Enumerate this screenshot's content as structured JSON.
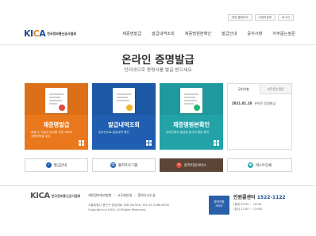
{
  "util_links": [
    "대표 홈페이지",
    "사용자등록",
    "로그인"
  ],
  "header": {
    "logo_mark_main": "KI",
    "logo_mark_accent": "C",
    "logo_mark_end": "A",
    "logo_text": "한국정보통신공사협회",
    "nav": [
      "제증명발급",
      "발급내역조회",
      "제증명원본확인",
      "발급안내",
      "공지사항",
      "자주묻는질문"
    ]
  },
  "hero": {
    "title": "온라인 증명발급",
    "subtitle": "인터넷으로 증명서를 발급 받으세요"
  },
  "cards": [
    {
      "title": "제증명발급",
      "desc": "회원사, 기술자·감리원 관련 자료의 제증명원을 발급"
    },
    {
      "title": "발급내역조회",
      "desc": "온라인으로 발급내역 확인"
    },
    {
      "title": "제증명원본확인",
      "desc": "온라인에서 발급된 문서의 원본 확인"
    }
  ],
  "notice": {
    "tabs": [
      "공지사항",
      "자주묻는질문"
    ],
    "items": [
      {
        "date": "2021.01.10",
        "title": "온라인 증명발급"
      }
    ]
  },
  "buttons": [
    {
      "label": "발급안내",
      "icon": "check-icon",
      "color": "#1f5eb0"
    },
    {
      "label": "출력프로그램",
      "icon": "print-icon",
      "color": "#1f5eb0"
    },
    {
      "label": "원격지원서비스",
      "icon": "support-icon",
      "color": "#e24b3b"
    },
    {
      "label": "테스트인쇄",
      "icon": "test-print-icon",
      "color": "#23a3a8"
    }
  ],
  "footer": {
    "logo_text": "한국정보통신공사협회",
    "links": [
      "개인정보처리방침",
      "시도회안내",
      "찾아오시는길"
    ],
    "address": "서울특별시 용산구 한강대로 308 (04334)   TEL 02-3488-6000",
    "copyright": "Copyright (c) KICA. All Rights Reserved.",
    "cs_badge_line1": "원격지원",
    "cs_badge_line2": "서비스",
    "cs_label": "민원콜센터",
    "cs_number": "1522-1122",
    "cs_hours_1": "(평일 09:00 ~ 18:00",
    "cs_hours_2": "(점심 12:00 ~ 13:00)"
  },
  "colors": {
    "orange": "#e9771b",
    "blue": "#1f5eb0",
    "teal": "#23a3a8",
    "brown": "#5c4537"
  }
}
